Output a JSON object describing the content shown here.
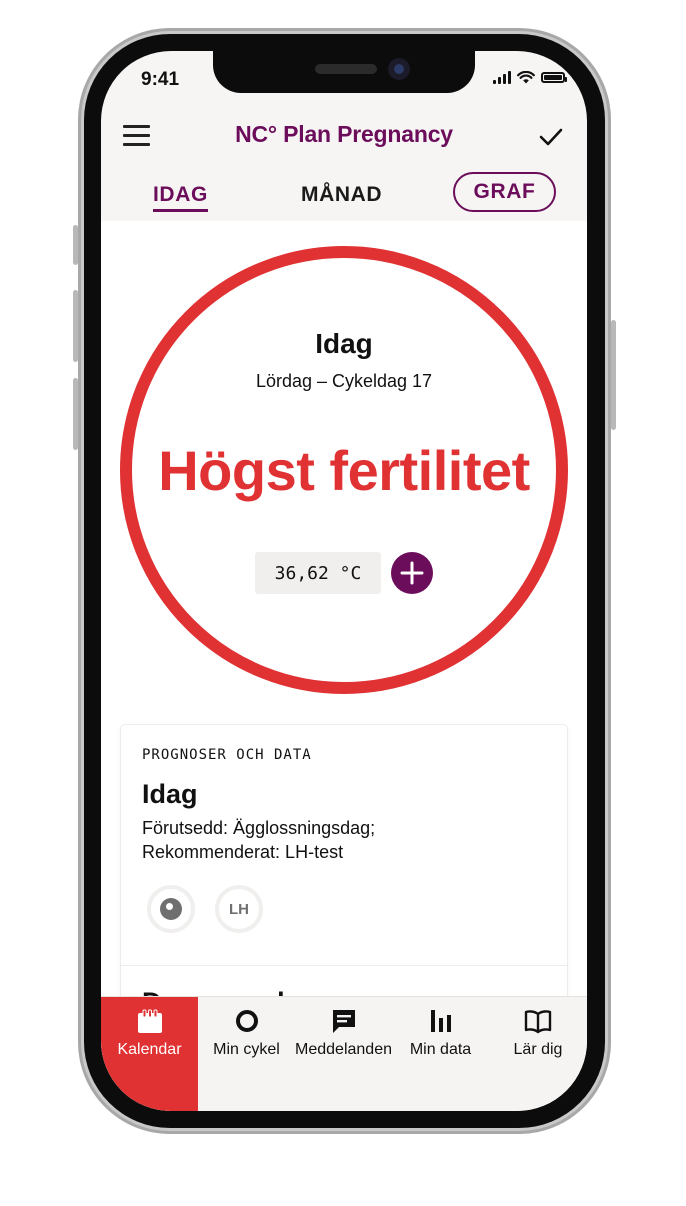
{
  "status_bar": {
    "time": "9:41"
  },
  "header": {
    "title": "NC° Plan Pregnancy"
  },
  "tabs": [
    {
      "label": "IDAG",
      "active": true
    },
    {
      "label": "MÅNAD",
      "active": false
    },
    {
      "label": "GRAF",
      "active": false
    }
  ],
  "today": {
    "title": "Idag",
    "subtitle": "Lördag – Cykeldag 17",
    "fertility_status": "Högst fertilitet",
    "temperature": "36,62 °C"
  },
  "card": {
    "kicker": "PROGNOSER OCH DATA",
    "title": "Idag",
    "line1": "Förutsedd: Ägglossningsdag;",
    "line2": "Rekommenderat: LH-test",
    "chip_lh": "LH",
    "next_title": "Denna vecka"
  },
  "bottom_nav": [
    {
      "label": "Kalendar",
      "icon": "calendar-icon",
      "active": true
    },
    {
      "label": "Min cykel",
      "icon": "cycle-icon",
      "active": false
    },
    {
      "label": "Meddelanden",
      "icon": "message-icon",
      "active": false
    },
    {
      "label": "Min data",
      "icon": "bar-chart-icon",
      "active": false
    },
    {
      "label": "Lär dig",
      "icon": "book-icon",
      "active": false
    }
  ],
  "colors": {
    "brand_purple": "#6b0d5b",
    "fertility_red": "#e03133"
  }
}
